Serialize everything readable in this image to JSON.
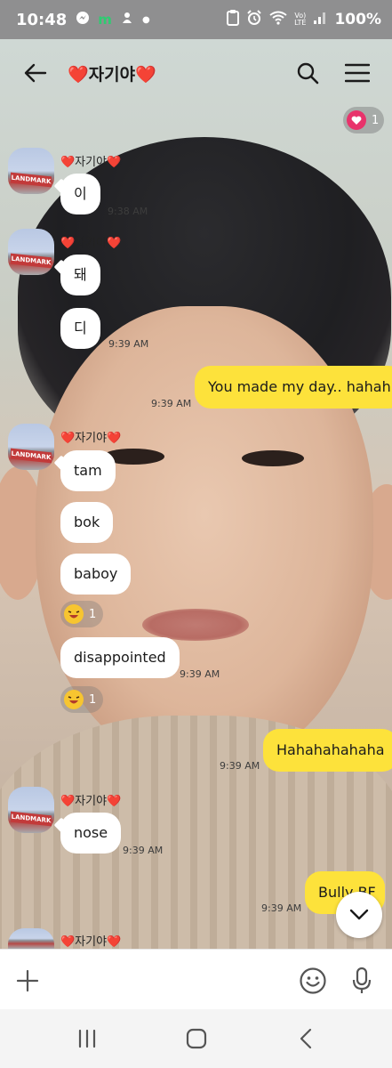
{
  "status_bar": {
    "time": "10:48",
    "battery": "100%",
    "left_icons": [
      "messenger-icon",
      "m-app-icon",
      "sync-icon",
      "dot-icon"
    ],
    "right_icons": [
      "clipboard-icon",
      "alarm-icon",
      "wifi-icon",
      "volte-icon",
      "signal-icon"
    ],
    "volte_label": "Vo)\nLTE"
  },
  "header": {
    "title": "❤️자기야❤️"
  },
  "like_badge": {
    "count": "1"
  },
  "sender_name": "❤️자기야❤️",
  "avatar_sign": "LANDMARK",
  "messages": [
    {
      "text": "이",
      "time": "9:38 AM"
    },
    {
      "text": "돼"
    },
    {
      "text": "디",
      "time": "9:39 AM"
    },
    {
      "text": "You made my day.. hahah",
      "time": "9:39 AM"
    },
    {
      "text": "tam"
    },
    {
      "text": "bok"
    },
    {
      "text": "baboy",
      "reaction_count": "1"
    },
    {
      "text": "disappointed",
      "time": "9:39 AM",
      "reaction_count": "1"
    },
    {
      "text": "Hahahahahaha",
      "time": "9:39 AM"
    },
    {
      "text": "nose",
      "time": "9:39 AM"
    },
    {
      "text": "Bully BF",
      "time": "9:39 AM"
    }
  ],
  "colors": {
    "outgoing_bubble": "#fde23b",
    "incoming_bubble": "#ffffff",
    "heart": "#e8336b",
    "status_bar": "#8f8f90"
  }
}
